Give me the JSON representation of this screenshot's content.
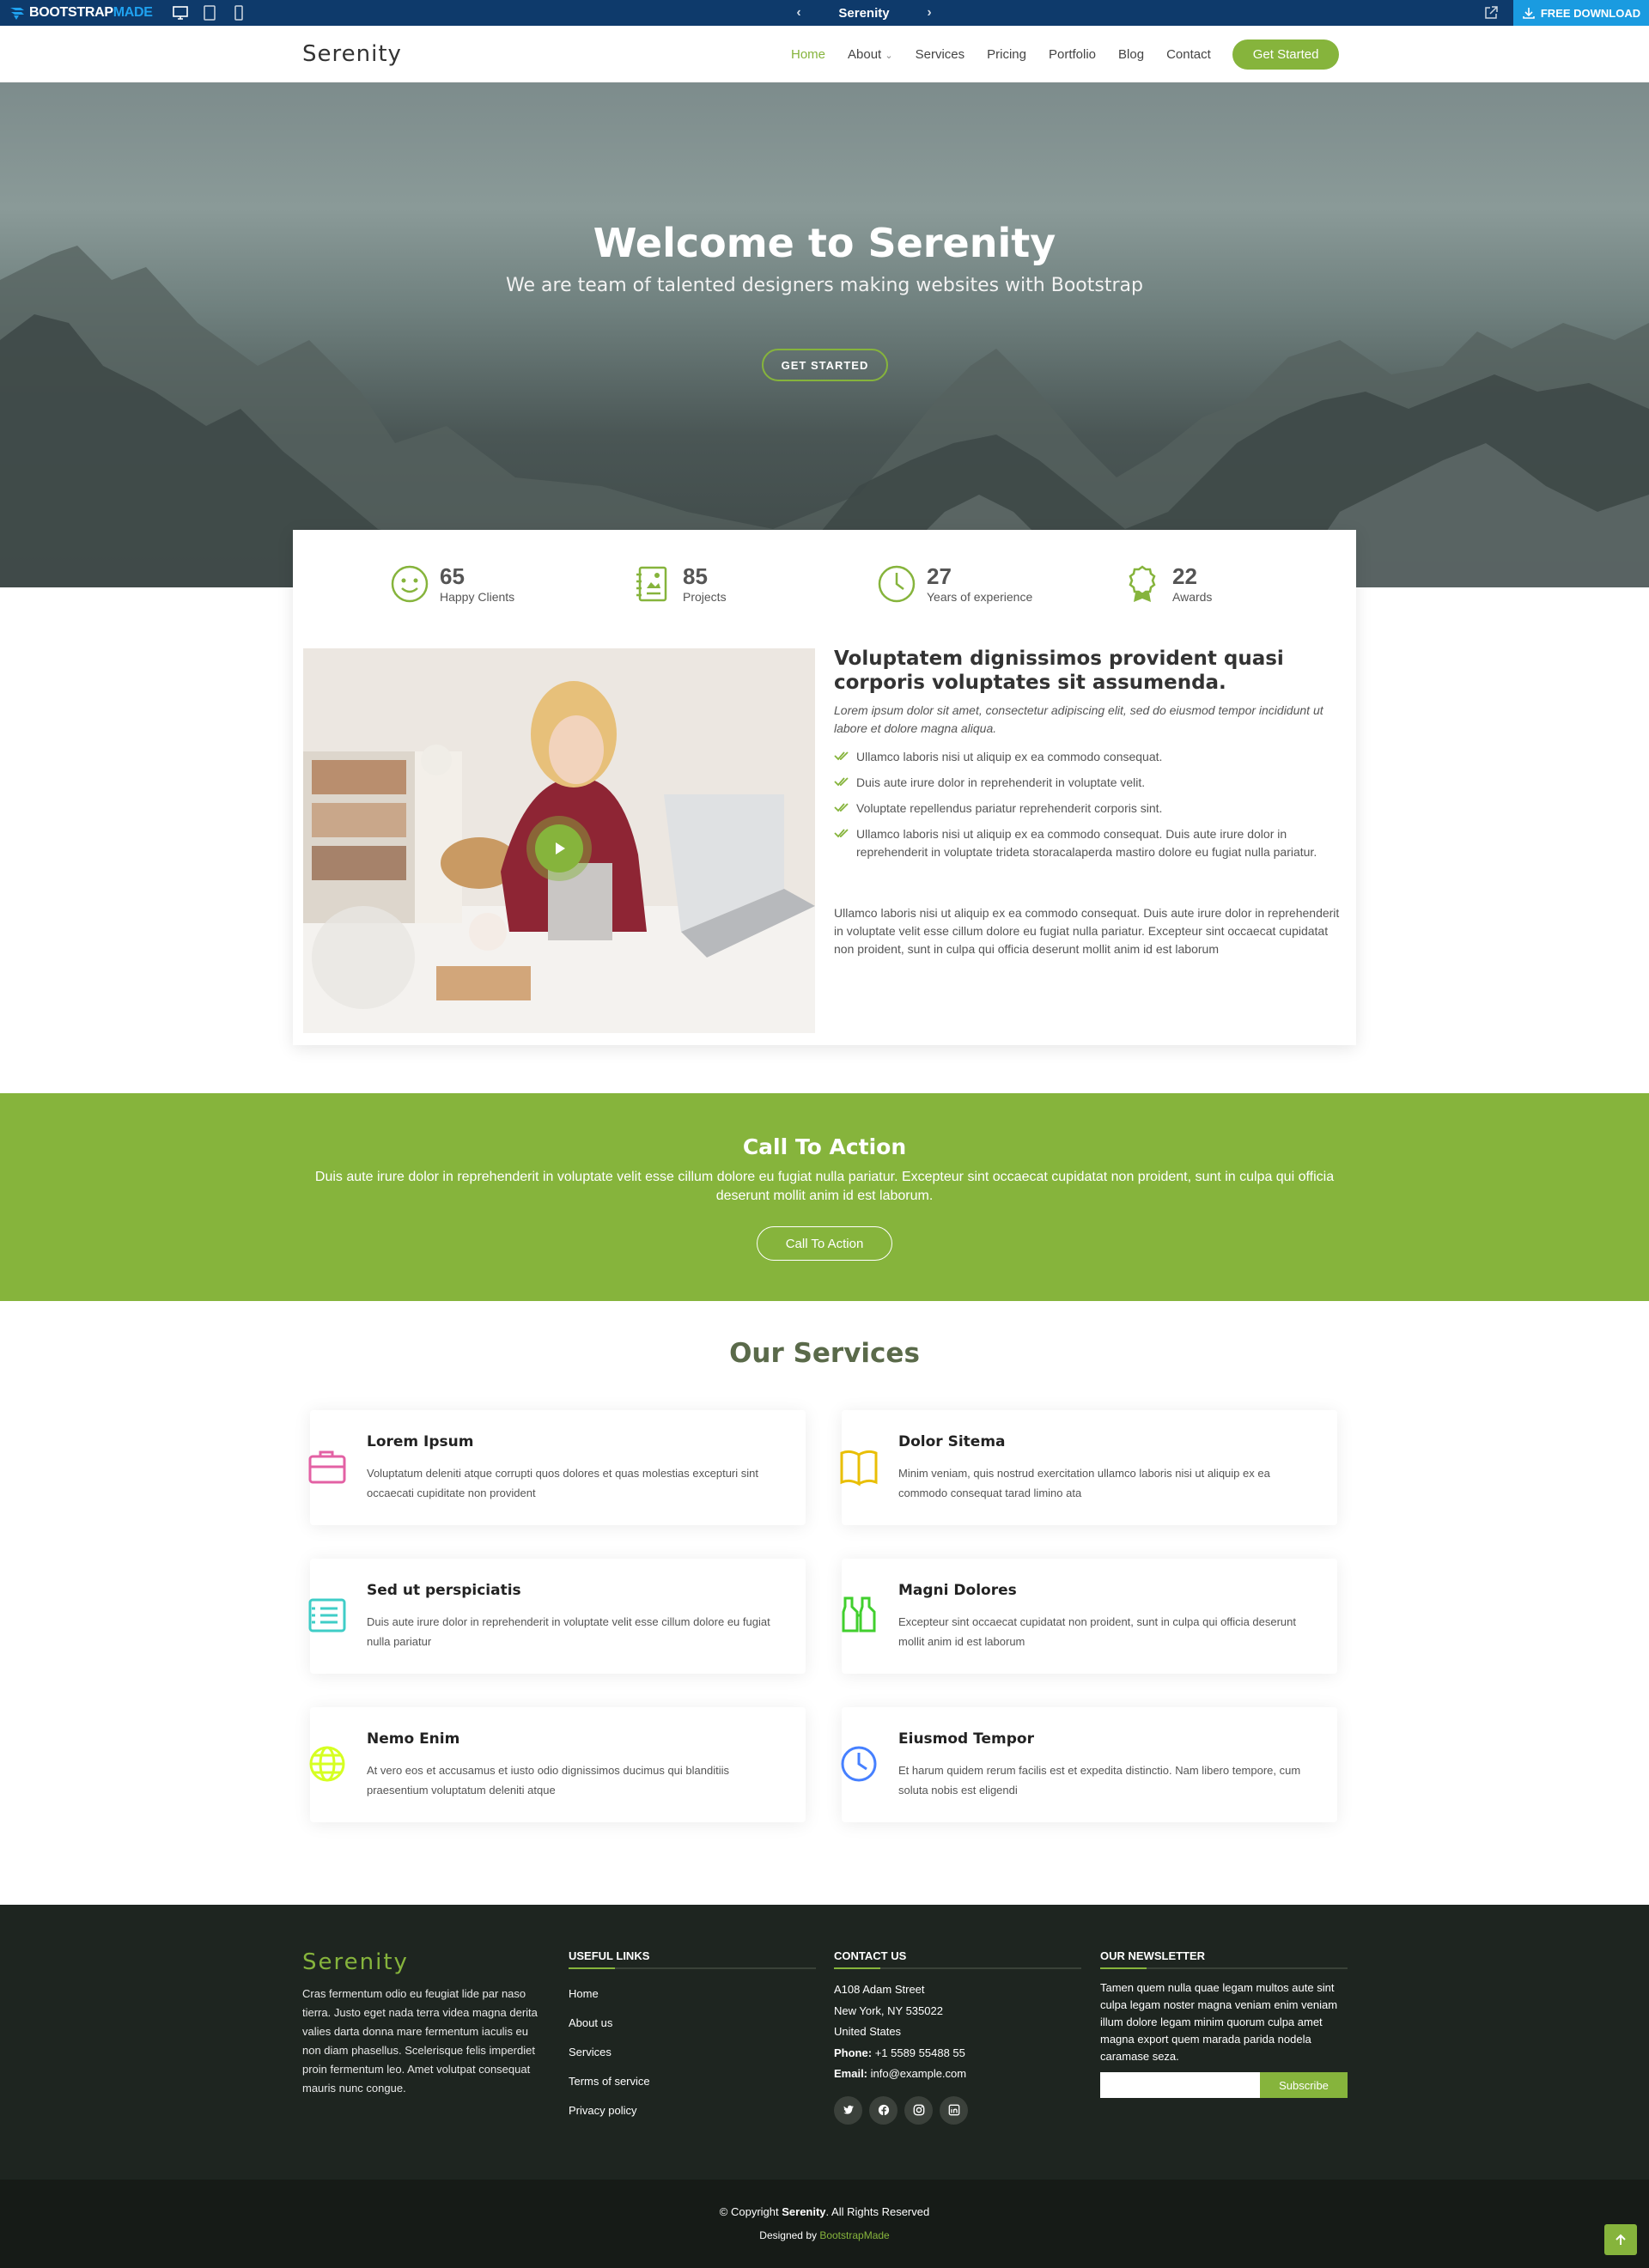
{
  "preview_bar": {
    "logo_part1": "BOOTSTRAP",
    "logo_part2": "MADE",
    "title": "Serenity",
    "prev_icon": "chevron-left-icon",
    "next_icon": "chevron-right-icon",
    "download_label": "FREE DOWNLOAD"
  },
  "header": {
    "brand": "Serenity",
    "nav": [
      {
        "label": "Home",
        "active": true
      },
      {
        "label": "About"
      },
      {
        "label": "Services"
      },
      {
        "label": "Pricing"
      },
      {
        "label": "Portfolio"
      },
      {
        "label": "Blog"
      },
      {
        "label": "Contact"
      }
    ],
    "cta_label": "Get Started"
  },
  "hero": {
    "title": "Welcome to Serenity",
    "subtitle": "We are team of talented designers making websites with Bootstrap",
    "button_label": "GET STARTED"
  },
  "counters": [
    {
      "value": "65",
      "label": "Happy Clients",
      "icon": "emoji-smile-icon"
    },
    {
      "value": "85",
      "label": "Projects",
      "icon": "journal-richtext-icon"
    },
    {
      "value": "27",
      "label": "Years of experience",
      "icon": "clock-icon"
    },
    {
      "value": "22",
      "label": "Awards",
      "icon": "award-icon"
    }
  ],
  "about": {
    "title": "Voluptatem dignissimos provident quasi corporis voluptates sit assumenda.",
    "lead": "Lorem ipsum dolor sit amet, consectetur adipiscing elit, sed do eiusmod tempor incididunt ut labore et dolore magna aliqua.",
    "list": [
      "Ullamco laboris nisi ut aliquip ex ea commodo consequat.",
      "Duis aute irure dolor in reprehenderit in voluptate velit.",
      "Voluptate repellendus pariatur reprehenderit corporis sint.",
      "Ullamco laboris nisi ut aliquip ex ea commodo consequat. Duis aute irure dolor in reprehenderit in voluptate trideta storacalaperda mastiro dolore eu fugiat nulla pariatur."
    ],
    "paragraph": "Ullamco laboris nisi ut aliquip ex ea commodo consequat. Duis aute irure dolor in reprehenderit in voluptate velit esse cillum dolore eu fugiat nulla pariatur. Excepteur sint occaecat cupidatat non proident, sunt in culpa qui officia deserunt mollit anim id est laborum"
  },
  "cta": {
    "title": "Call To Action",
    "text": "Duis aute irure dolor in reprehenderit in voluptate velit esse cillum dolore eu fugiat nulla pariatur. Excepteur sint occaecat cupidatat non proident, sunt in culpa qui officia deserunt mollit anim id est laborum.",
    "button_label": "Call To Action"
  },
  "services": {
    "title": "Our Services",
    "items": [
      {
        "title": "Lorem Ipsum",
        "text": "Voluptatum deleniti atque corrupti quos dolores et quas molestias excepturi sint occaecati cupiditate non provident",
        "icon": "briefcase-icon",
        "color": "#e361a4"
      },
      {
        "title": "Dolor Sitema",
        "text": "Minim veniam, quis nostrud exercitation ullamco laboris nisi ut aliquip ex ea commodo consequat tarad limino ata",
        "icon": "book-icon",
        "color": "#e9bf06"
      },
      {
        "title": "Sed ut perspiciatis",
        "text": "Duis aute irure dolor in reprehenderit in voluptate velit esse cillum dolore eu fugiat nulla pariatur",
        "icon": "card-checklist-icon",
        "color": "#3fcdc7"
      },
      {
        "title": "Magni Dolores",
        "text": "Excepteur sint occaecat cupidatat non proident, sunt in culpa qui officia deserunt mollit anim id est laborum",
        "icon": "binoculars-icon",
        "color": "#41cf2e"
      },
      {
        "title": "Nemo Enim",
        "text": "At vero eos et accusamus et iusto odio dignissimos ducimus qui blanditiis praesentium voluptatum deleniti atque",
        "icon": "globe-icon",
        "color": "#d6ff22"
      },
      {
        "title": "Eiusmod Tempor",
        "text": "Et harum quidem rerum facilis est et expedita distinctio. Nam libero tempore, cum soluta nobis est eligendi",
        "icon": "clock-icon",
        "color": "#4680ff"
      }
    ]
  },
  "footer": {
    "brand": "Serenity",
    "about": "Cras fermentum odio eu feugiat lide par naso tierra. Justo eget nada terra videa magna derita valies darta donna mare fermentum iaculis eu non diam phasellus. Scelerisque felis imperdiet proin fermentum leo. Amet volutpat consequat mauris nunc congue.",
    "links_title": "USEFUL LINKS",
    "links": [
      "Home",
      "About us",
      "Services",
      "Terms of service",
      "Privacy policy"
    ],
    "contact_title": "CONTACT US",
    "address1": "A108 Adam Street",
    "address2": "New York, NY 535022",
    "country": "United States",
    "phone_label": "Phone:",
    "phone": "+1 5589 55488 55",
    "email_label": "Email:",
    "email": "info@example.com",
    "newsletter_title": "OUR NEWSLETTER",
    "newsletter_text": "Tamen quem nulla quae legam multos aute sint culpa legam noster magna veniam enim veniam illum dolore legam minim quorum culpa amet magna export quem marada parida nodela caramase seza.",
    "subscribe_label": "Subscribe",
    "copyright_prefix": "© Copyright ",
    "copyright_brand": "Serenity",
    "copyright_suffix": ". All Rights Reserved",
    "designed_prefix": "Designed by ",
    "designed_by": "BootstrapMade"
  },
  "colors": {
    "accent": "#86b43c",
    "preview_bar": "#0e3a6b",
    "download": "#1a9be0",
    "footer": "#1e2520"
  }
}
